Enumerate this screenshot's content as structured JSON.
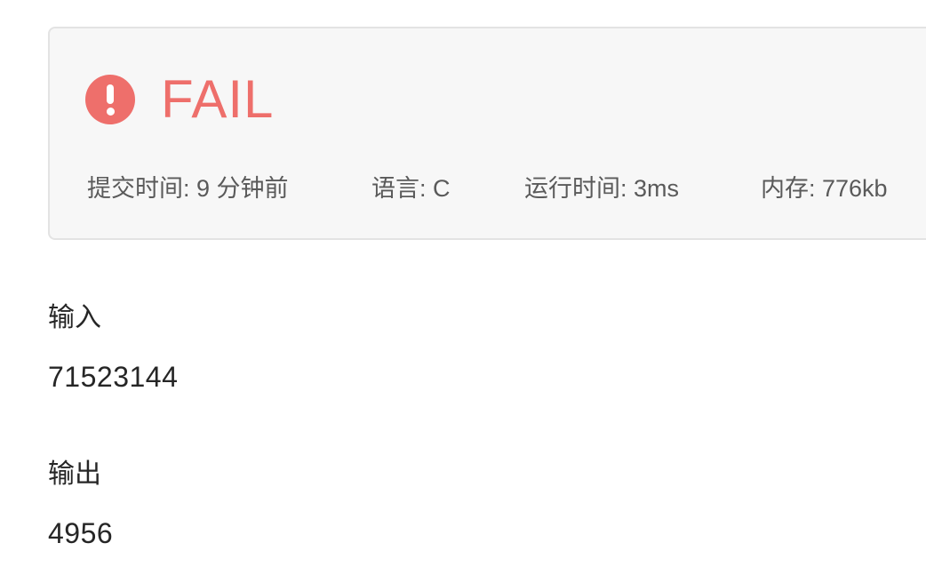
{
  "result": {
    "status": "FAIL",
    "status_icon": "exclamation-circle-icon",
    "status_color": "#ee6f6b",
    "meta": {
      "submit_time": "提交时间: 9 分钟前",
      "language": "语言: C",
      "run_time": "运行时间: 3ms",
      "memory": "内存: 776kb"
    }
  },
  "input": {
    "label": "输入",
    "value": "71523144"
  },
  "output": {
    "label": "输出",
    "value": "4956"
  }
}
